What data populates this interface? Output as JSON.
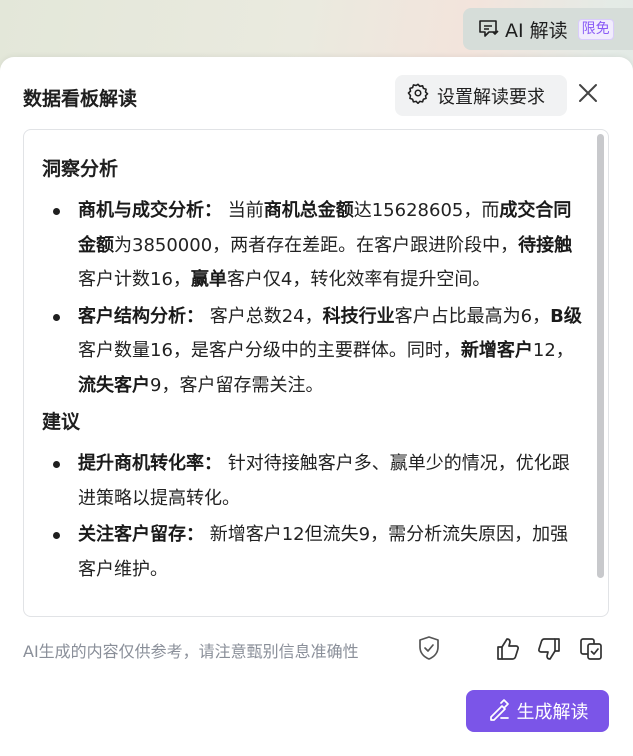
{
  "top_button": {
    "label": "AI 解读",
    "badge": "限免"
  },
  "panel": {
    "title": "数据看板解读",
    "requirements_label": "设置解读要求"
  },
  "content": {
    "insight_heading": "洞察分析",
    "insights": [
      {
        "segments": [
          {
            "t": "商机与成交分析：",
            "b": true
          },
          {
            "t": " 当前",
            "b": false
          },
          {
            "t": "商机总金额",
            "b": true
          },
          {
            "t": "达15628605，而",
            "b": false
          },
          {
            "t": "成交合同金额",
            "b": true
          },
          {
            "t": "为3850000，两者存在差距。在客户跟进阶段中，",
            "b": false
          },
          {
            "t": "待接触",
            "b": true
          },
          {
            "t": "客户计数16，",
            "b": false
          },
          {
            "t": "赢单",
            "b": true
          },
          {
            "t": "客户仅4，转化效率有提升空间。",
            "b": false
          }
        ]
      },
      {
        "segments": [
          {
            "t": "客户结构分析：",
            "b": true
          },
          {
            "t": " 客户总数24，",
            "b": false
          },
          {
            "t": "科技行业",
            "b": true
          },
          {
            "t": "客户占比最高为6，",
            "b": false
          },
          {
            "t": "B级",
            "b": true
          },
          {
            "t": "客户数量16，是客户分级中的主要群体。同时，",
            "b": false
          },
          {
            "t": "新增客户",
            "b": true
          },
          {
            "t": "12，",
            "b": false
          },
          {
            "t": "流失客户",
            "b": true
          },
          {
            "t": "9，客户留存需关注。",
            "b": false
          }
        ]
      }
    ],
    "suggest_heading": "建议",
    "suggestions": [
      {
        "segments": [
          {
            "t": "提升商机转化率：",
            "b": true
          },
          {
            "t": " 针对待接触客户多、赢单少的情况，优化跟进策略以提高转化。",
            "b": false
          }
        ]
      },
      {
        "segments": [
          {
            "t": "关注客户留存：",
            "b": true
          },
          {
            "t": " 新增客户12但流失9，需分析流失原因，加强客户维护。",
            "b": false
          }
        ]
      }
    ]
  },
  "footer": {
    "disclaimer": "AI生成的内容仅供参考，请注意甄别信息准确性",
    "generate_label": "生成解读"
  },
  "colors": {
    "accent": "#7b55e8",
    "badge_text": "#8b5cf6",
    "muted": "#8a8f99"
  },
  "icons": {
    "top_button": "ai-interpret-icon",
    "requirements": "gear-icon",
    "close": "close-icon",
    "disclaimer": "shield-check-icon",
    "like": "thumbs-up-icon",
    "dislike": "thumbs-down-icon",
    "copy": "copy-icon",
    "generate": "magic-pen-icon"
  }
}
